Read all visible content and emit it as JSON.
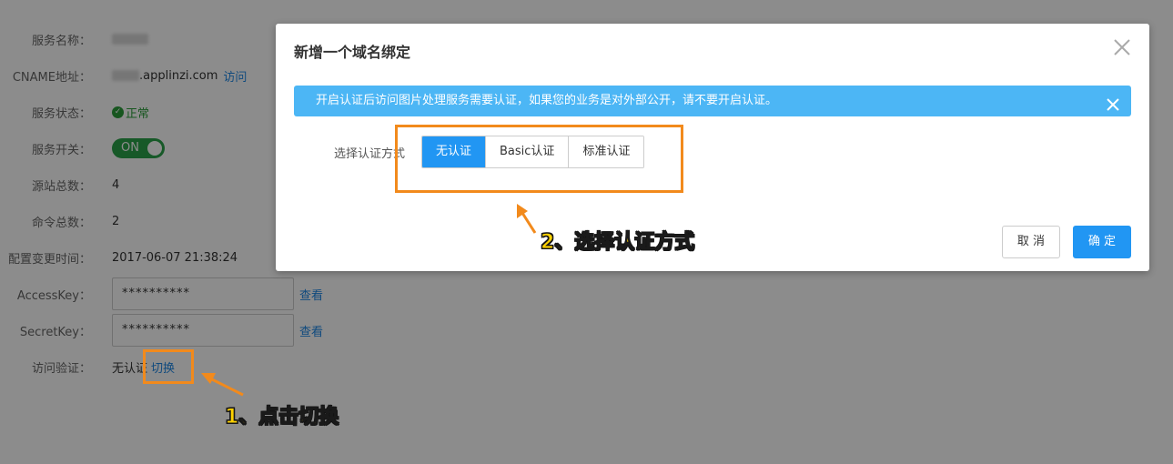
{
  "service": {
    "rows": [
      {
        "label": "服务名称：",
        "value": ""
      },
      {
        "label": "CNAME地址：",
        "value": ".applinzi.com",
        "link": "访问"
      },
      {
        "label": "服务状态：",
        "value": "正常"
      },
      {
        "label": "服务开关：",
        "value": "ON"
      },
      {
        "label": "源站总数：",
        "value": "4"
      },
      {
        "label": "命令总数：",
        "value": "2"
      },
      {
        "label": "配置变更时间：",
        "value": "2017-06-07 21:38:24"
      },
      {
        "label": "AccessKey：",
        "value": "**********",
        "link": "查看"
      },
      {
        "label": "SecretKey：",
        "value": "**********",
        "link": "查看"
      },
      {
        "label": "访问验证：",
        "value": "无认证",
        "link": "切换"
      }
    ]
  },
  "modal": {
    "title": "新增一个域名绑定",
    "alert": "开启认证后访问图片处理服务需要认证，如果您的业务是对外部公开，请不要开启认证。",
    "auth_label": "选择认证方式",
    "options": [
      "无认证",
      "Basic认证",
      "标准认证"
    ],
    "selected": "无认证",
    "cancel": "取 消",
    "confirm": "确 定"
  },
  "annotations": {
    "step1": "1、点击切换",
    "step2": "2、选择认证方式"
  },
  "colors": {
    "primary": "#2196f3",
    "success": "#2a9d3a",
    "alert_bg": "#4cb6f5",
    "annotation_border": "#f28a1c",
    "annotation_text": "#ffd200"
  }
}
